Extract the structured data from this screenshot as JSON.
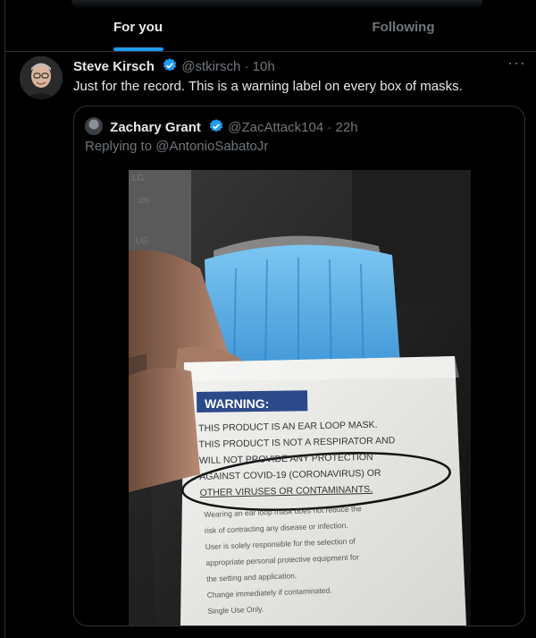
{
  "tabs": [
    {
      "label": "For you",
      "active": true
    },
    {
      "label": "Following",
      "active": false
    }
  ],
  "tweet": {
    "author_name": "Steve Kirsch",
    "handle": "@stkirsch",
    "separator": "·",
    "time": "10h",
    "text": "Just for the record. This is a warning label on every box of masks.",
    "more": "···"
  },
  "quote": {
    "author_name": "Zachary Grant",
    "handle": "@ZacAttack104",
    "separator": "·",
    "time": "22h",
    "reply_prefix": "Replying to",
    "reply_to": "@AntonioSabatoJr"
  },
  "photo_label": {
    "box_marks": [
      "LG",
      "100",
      "LG"
    ],
    "header": "WARNING:",
    "lines": [
      "THIS PRODUCT IS AN EAR LOOP MASK.",
      "THIS PRODUCT IS NOT A RESPIRATOR AND",
      "WILL NOT PROVIDE ANY PROTECTION",
      "AGAINST COVID-19 (CORONAVIRUS) OR",
      "OTHER VIRUSES OR CONTAMINANTS."
    ],
    "small_lines": [
      "Wearing an ear loop mask does not reduce the",
      "risk of contracting any disease or infection.",
      "User is solely responsible for the selection of",
      "appropriate personal protective equipment for",
      "the setting and application.",
      "Change immediately if contaminated.",
      "Single Use Only."
    ]
  },
  "colors": {
    "accent": "#1d9bf0",
    "secondary_text": "#71767b",
    "border": "#2f3336",
    "warning_banner": "#2c4a8a",
    "mask_blue": "#5fb2e8",
    "marker_circle": "#111111"
  },
  "icons": [
    "verified-badge-icon",
    "more-options-icon"
  ]
}
